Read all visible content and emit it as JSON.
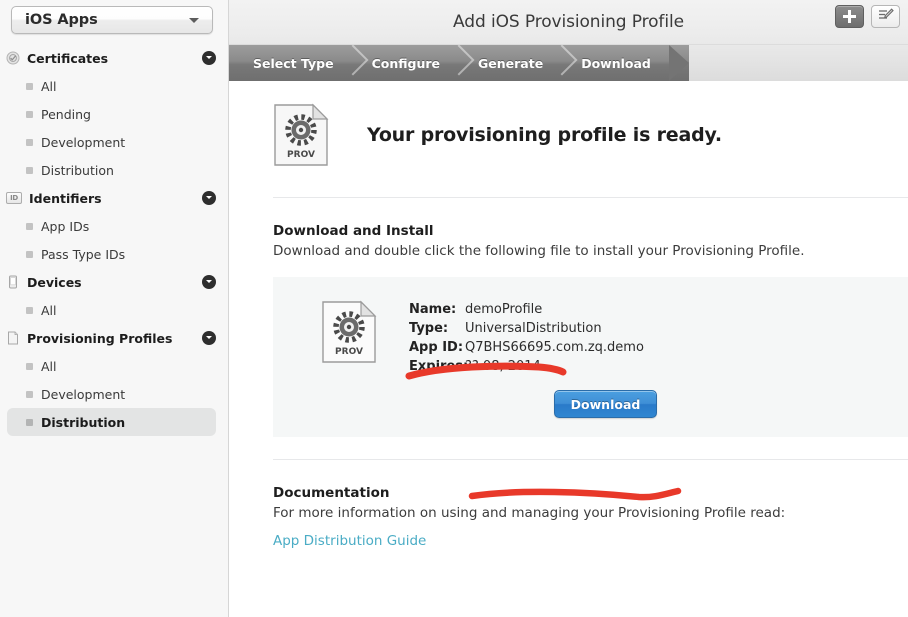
{
  "sidebar": {
    "app_selector": {
      "value": "iOS Apps",
      "arrow_icon": "chevron-down-icon"
    },
    "groups": [
      {
        "title": "Certificates",
        "icon": "certificate-seal-icon",
        "disclosure_icon": "chevron-down-circle-icon",
        "items": [
          {
            "label": "All",
            "selected": false
          },
          {
            "label": "Pending",
            "selected": false
          },
          {
            "label": "Development",
            "selected": false
          },
          {
            "label": "Distribution",
            "selected": false
          }
        ]
      },
      {
        "title": "Identifiers",
        "icon": "id-badge-icon",
        "disclosure_icon": "chevron-down-circle-icon",
        "items": [
          {
            "label": "App IDs",
            "selected": false
          },
          {
            "label": "Pass Type IDs",
            "selected": false
          }
        ]
      },
      {
        "title": "Devices",
        "icon": "device-phone-icon",
        "disclosure_icon": "chevron-down-circle-icon",
        "items": [
          {
            "label": "All",
            "selected": false
          }
        ]
      },
      {
        "title": "Provisioning Profiles",
        "icon": "document-icon",
        "disclosure_icon": "chevron-down-circle-icon",
        "items": [
          {
            "label": "All",
            "selected": false
          },
          {
            "label": "Development",
            "selected": false
          },
          {
            "label": "Distribution",
            "selected": true
          }
        ]
      }
    ]
  },
  "titlebar": {
    "title": "Add iOS Provisioning Profile",
    "add_button_icon": "plus-icon",
    "edit_button_icon": "edit-pencil-icon"
  },
  "steps": {
    "items": [
      {
        "label": "Select Type",
        "state": "done"
      },
      {
        "label": "Configure",
        "state": "done"
      },
      {
        "label": "Generate",
        "state": "done"
      },
      {
        "label": "Download",
        "state": "active"
      }
    ]
  },
  "main": {
    "ready_heading": "Your provisioning profile is ready.",
    "ready_icon": "provisioning-profile-file-icon",
    "ready_icon_label": "PROV",
    "download_section": {
      "heading": "Download and Install",
      "subtext": "Download and double click the following file to install your Provisioning Profile."
    },
    "profile": {
      "icon": "provisioning-profile-file-icon",
      "icon_label": "PROV",
      "fields": [
        {
          "key": "Name:",
          "value": "demoProfile"
        },
        {
          "key": "Type:",
          "value": "UniversalDistribution"
        },
        {
          "key": "App ID:",
          "value": "Q7BHS66695.com.zq.demo"
        },
        {
          "key": "Expires:",
          "value": "?? 08, 2014"
        }
      ],
      "download_button_label": "Download"
    },
    "documentation": {
      "heading": "Documentation",
      "subtext": "For more information on using and managing your Provisioning Profile read:",
      "link_label": "App Distribution Guide"
    }
  },
  "annotations": {
    "color": "#e8392a",
    "marks": [
      {
        "name": "underline-over-type-row"
      },
      {
        "name": "underline-below-profile-box"
      }
    ]
  }
}
